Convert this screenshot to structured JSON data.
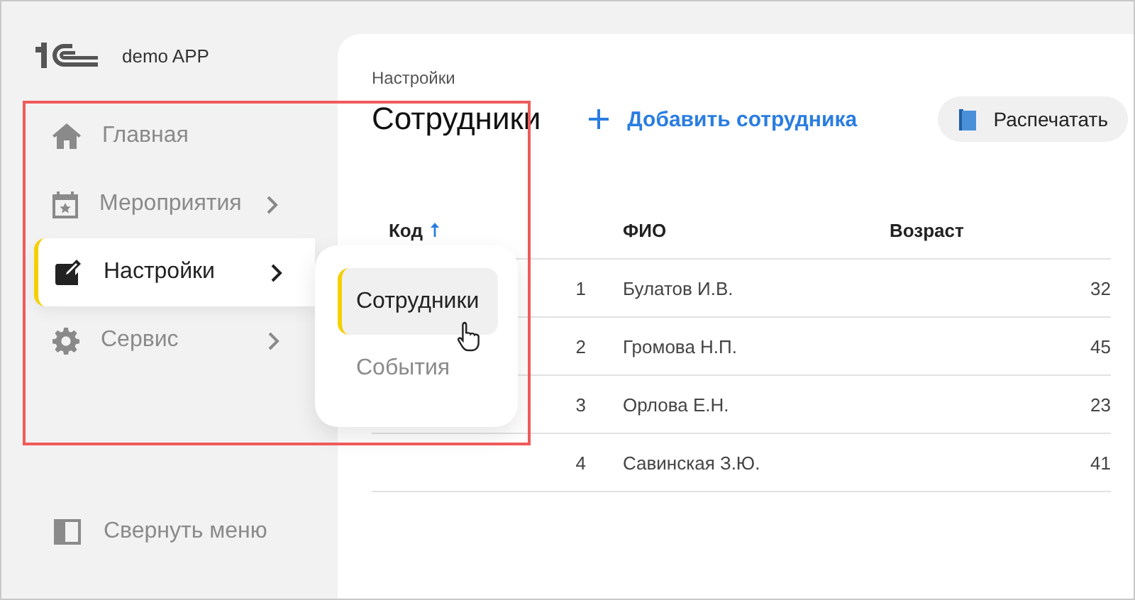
{
  "app": {
    "name": "demo APP"
  },
  "sidebar": {
    "items": [
      {
        "label": "Главная",
        "kind": "home",
        "has_submenu": false,
        "selected": false
      },
      {
        "label": "Мероприятия",
        "kind": "calendar",
        "has_submenu": true,
        "selected": false
      },
      {
        "label": "Настройки",
        "kind": "edit",
        "has_submenu": true,
        "selected": true,
        "children": [
          {
            "label": "Сотрудники",
            "selected": true
          },
          {
            "label": "События",
            "selected": false
          }
        ]
      },
      {
        "label": "Сервис",
        "kind": "gear",
        "has_submenu": true,
        "selected": false
      }
    ],
    "collapse": "Свернуть меню"
  },
  "breadcrumb": "Настройки",
  "title": "Сотрудники",
  "add_button": "Добавить сотрудника",
  "print_button": "Распечатать",
  "table": {
    "columns": [
      {
        "label": "Код",
        "sorted": true
      },
      {
        "label": "ФИО",
        "sorted": false
      },
      {
        "label": "Возраст",
        "sorted": false
      }
    ],
    "rows": [
      [
        "1",
        "Булатов И.В.",
        "32"
      ],
      [
        "2",
        "Громова Н.П.",
        "45"
      ],
      [
        "3",
        "Орлова Е.Н.",
        "23"
      ],
      [
        "4",
        "Савинская З.Ю.",
        "41"
      ]
    ]
  }
}
